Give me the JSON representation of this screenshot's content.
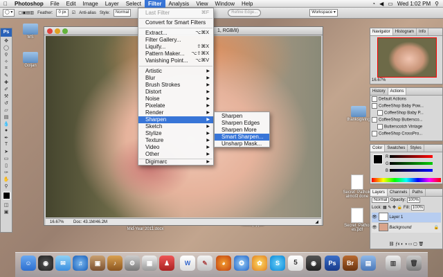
{
  "menubar": {
    "apple": "",
    "app_name": "Photoshop",
    "menus": [
      "File",
      "Edit",
      "Image",
      "Layer",
      "Select",
      "Filter",
      "Analysis",
      "View",
      "Window",
      "Help"
    ],
    "active_menu": "Filter",
    "clock": "Wed 1:02 PM"
  },
  "options_bar": {
    "feather_label": "Feather:",
    "feather_value": "0 px",
    "antialias_label": "Anti-alias",
    "style_label": "Style:",
    "style_value": "Normal",
    "refine_edge": "Refine Edge...",
    "workspace": "Workspace ▾"
  },
  "document": {
    "title_fragment": "1, RGB/8)",
    "zoom": "16.67%",
    "doc_info": "Doc: 43.1M/46.2M"
  },
  "filter_menu": {
    "last_filter": "Last Filter",
    "last_filter_shortcut": "⌘F",
    "convert_smart": "Convert for Smart Filters",
    "items_top": [
      {
        "label": "Extract...",
        "shortcut": "⌥⌘X"
      },
      {
        "label": "Filter Gallery...",
        "shortcut": ""
      },
      {
        "label": "Liquify...",
        "shortcut": "⇧⌘X"
      },
      {
        "label": "Pattern Maker...",
        "shortcut": "⌥⇧⌘X"
      },
      {
        "label": "Vanishing Point...",
        "shortcut": "⌥⌘V"
      }
    ],
    "submenus": [
      "Artistic",
      "Blur",
      "Brush Strokes",
      "Distort",
      "Noise",
      "Pixelate",
      "Render",
      "Sharpen",
      "Sketch",
      "Stylize",
      "Texture",
      "Video",
      "Other"
    ],
    "highlighted": "Sharpen",
    "digimarc": "Digimarc"
  },
  "sharpen_submenu": {
    "items": [
      "Sharpen",
      "Sharpen Edges",
      "Sharpen More",
      "Smart Sharpen...",
      "Unsharp Mask..."
    ],
    "highlighted": "Smart Sharpen..."
  },
  "desktop_icons": {
    "left_folder1": "MS",
    "left_folder2": "Goljan",
    "right_folder1": "thanksgiving",
    "right_doc1": "Secret_Patholo almost done",
    "right_doc2": "Secret_Pathol es.pdf",
    "bottom_doc1": "Physical Diagnosis Mid-Year 2011.docx",
    "bottom_doc2": "Notes(2).pdf"
  },
  "navigator_panel": {
    "tabs": [
      "Navigator",
      "Histogram",
      "Info"
    ],
    "zoom": "16.67%"
  },
  "actions_panel": {
    "tabs": [
      "History",
      "Actions"
    ],
    "rows": [
      "Default Actions",
      "CoffeeShop Baby Pow...",
      "CoffeeShop Baby P...",
      "CoffeeShop Buttersco...",
      "Butterscotch Vintage",
      "CoffeeShop CrossPro..."
    ]
  },
  "color_panel": {
    "tabs": [
      "Color",
      "Swatches",
      "Styles"
    ],
    "channels": [
      "R",
      "G",
      "B"
    ]
  },
  "layers_panel": {
    "tabs": [
      "Layers",
      "Channels",
      "Paths"
    ],
    "blend_mode": "Normal",
    "opacity_label": "Opacity:",
    "opacity_value": "100%",
    "lock_label": "Lock:",
    "fill_label": "Fill:",
    "fill_value": "100%",
    "layers": [
      "Layer 1",
      "Background"
    ]
  },
  "dock": {
    "photoshop_label": "Ps",
    "bridge_label": "Br",
    "calendar_day": "5"
  },
  "colors": {
    "menu_highlight": "#3875d7",
    "ps_blue": "#2a62b8"
  }
}
